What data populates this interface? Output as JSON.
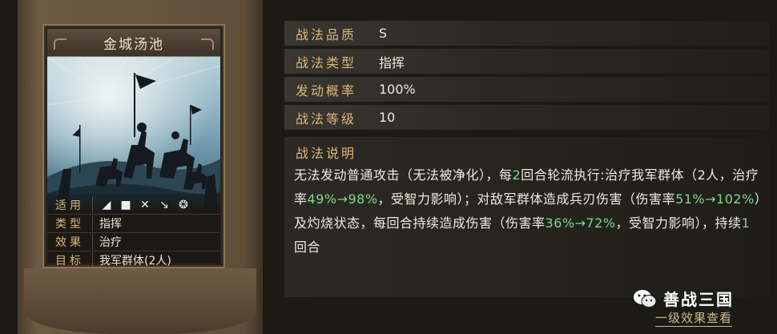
{
  "card": {
    "title": "金城汤池",
    "stats": [
      {
        "label": "适用",
        "type": "icons"
      },
      {
        "label": "类型",
        "value": "指挥"
      },
      {
        "label": "效果",
        "value": "治疗"
      },
      {
        "label": "目标",
        "value": "我军群体(2人)"
      }
    ],
    "troop_icons": [
      "cavalry-icon",
      "shield-icon",
      "archer-icon",
      "spear-icon",
      "chariot-icon"
    ]
  },
  "info": [
    {
      "label": "战法品质",
      "value": "S"
    },
    {
      "label": "战法类型",
      "value": "指挥"
    },
    {
      "label": "发动概率",
      "value": "100%"
    },
    {
      "label": "战法等级",
      "value": "10"
    }
  ],
  "description": {
    "title": "战法说明",
    "text_parts": [
      {
        "t": "无法发动普通攻击（无法被净化），每",
        "hl": false
      },
      {
        "t": "2",
        "hl": true
      },
      {
        "t": "回合轮流执行:治疗我军群体（2人，治疗率",
        "hl": false
      },
      {
        "t": "49%→98%",
        "hl": true
      },
      {
        "t": "，受智力影响）；对敌军群体造成兵刃伤害（伤害率",
        "hl": false
      },
      {
        "t": "51%→102%",
        "hl": true
      },
      {
        "t": "）及灼烧状态，每回合持续造成伤害（伤害率",
        "hl": false
      },
      {
        "t": "36%→72%",
        "hl": true
      },
      {
        "t": "，受智力影响），持续",
        "hl": false
      },
      {
        "t": "1",
        "hl": true
      },
      {
        "t": "回合",
        "hl": false
      }
    ]
  },
  "watermark": {
    "text": "善战三国"
  },
  "link": {
    "label": "一级效果查看"
  },
  "colors": {
    "gold": "#d9b77a",
    "highlight": "#7fd98a",
    "text": "#efe9de"
  }
}
